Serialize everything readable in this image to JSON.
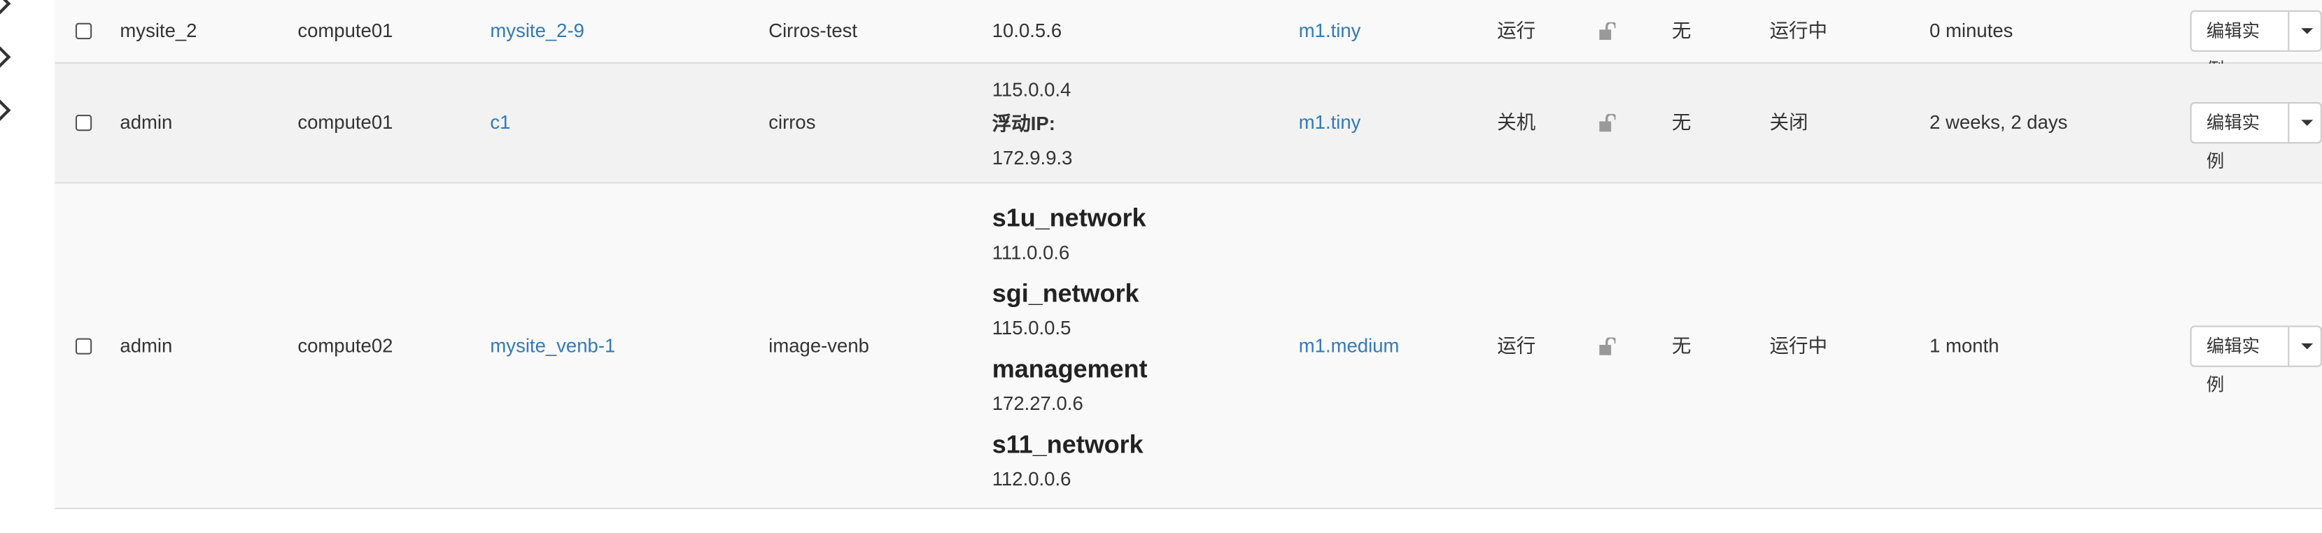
{
  "rows": [
    {
      "project": "mysite_2",
      "host": "compute01",
      "name": "mysite_2-9",
      "image": "Cirros-test",
      "ip_lines": [
        "10.0.5.6"
      ],
      "flavor": "m1.tiny",
      "state": "运行",
      "task": "无",
      "power": "运行中",
      "age": "0 minutes",
      "action": "编辑实例"
    },
    {
      "project": "admin",
      "host": "compute01",
      "name": "c1",
      "image": "cirros",
      "ip_lines": [
        "115.0.0.4",
        "浮动IP:",
        "172.9.9.3"
      ],
      "flavor": "m1.tiny",
      "state": "关机",
      "task": "无",
      "power": "关闭",
      "age": "2 weeks, 2 days",
      "action": "编辑实例"
    },
    {
      "project": "admin",
      "host": "compute02",
      "name": "mysite_venb-1",
      "image": "image-venb",
      "networks": [
        {
          "name": "s1u_network",
          "ip": "111.0.0.6"
        },
        {
          "name": "sgi_network",
          "ip": "115.0.0.5"
        },
        {
          "name": "management",
          "ip": "172.27.0.6"
        },
        {
          "name": "s11_network",
          "ip": "112.0.0.6"
        }
      ],
      "flavor": "m1.medium",
      "state": "运行",
      "task": "无",
      "power": "运行中",
      "age": "1 month",
      "action": "编辑实例"
    }
  ]
}
